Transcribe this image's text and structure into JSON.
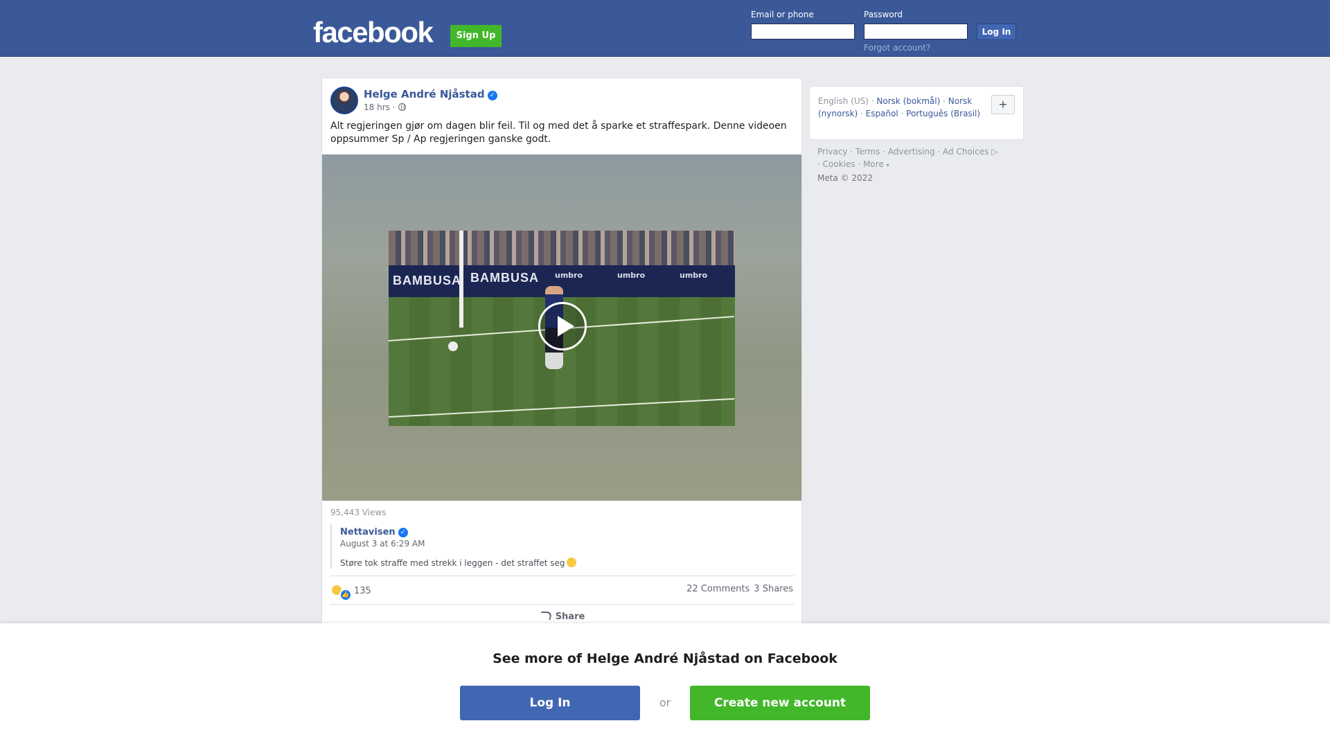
{
  "header": {
    "logo": "facebook",
    "signup_label": "Sign Up",
    "email_label": "Email or phone",
    "email_value": "",
    "password_label": "Password",
    "password_value": "",
    "login_label": "Log In",
    "forgot_label": "Forgot account?"
  },
  "post": {
    "author": "Helge André Njåstad",
    "time": "18 hrs ·",
    "text": "Alt regjeringen gjør om dagen blir feil. Til og med det å sparke et straffespark. Denne videoen oppsummer Sp / Ap regjeringen ganske godt.",
    "video": {
      "banner_left": "BAMBUSA",
      "banner_right": "BAMBUSA",
      "brand": "umbro"
    },
    "views": "95,443 Views",
    "shared": {
      "author": "Nettavisen",
      "date": "August 3 at 6:29 AM",
      "text": "Støre tok straffe med strekk i leggen - det straffet seg"
    },
    "reaction_count": "135",
    "comments": "22 Comments",
    "shares": "3 Shares",
    "share_label": "Share"
  },
  "sidebar": {
    "languages": [
      {
        "label": "English (US)",
        "current": true
      },
      {
        "label": "Norsk (bokmål)",
        "current": false
      },
      {
        "label": "Norsk (nynorsk)",
        "current": false
      },
      {
        "label": "Español",
        "current": false
      },
      {
        "label": "Português (Brasil)",
        "current": false
      }
    ],
    "more_languages_label": "+",
    "footer": {
      "privacy": "Privacy",
      "terms": "Terms",
      "advertising": "Advertising",
      "ad_choices": "Ad Choices",
      "cookies": "Cookies",
      "more": "More",
      "copyright": "Meta © 2022"
    }
  },
  "overlay": {
    "title": "See more of Helge André Njåstad on Facebook",
    "login_label": "Log In",
    "or_label": "or",
    "create_label": "Create new account"
  },
  "colors": {
    "brand_blue": "#3b5998",
    "button_blue": "#4267b2",
    "link_blue": "#385898",
    "signup_green": "#42b72a",
    "page_bg": "#e9ebee"
  },
  "icons": [
    "verified-badge-icon",
    "globe-icon",
    "play-icon",
    "haha-reaction-icon",
    "like-reaction-icon",
    "share-icon",
    "ad-choices-icon",
    "emoji-icon"
  ]
}
